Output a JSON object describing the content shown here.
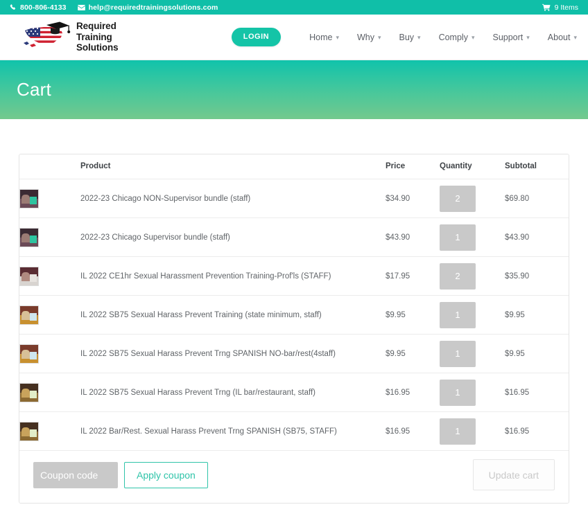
{
  "topbar": {
    "phone": "800-806-4133",
    "phone_icon": "phone-icon",
    "email": "help@requiredtrainingsolutions.com",
    "email_icon": "envelope-icon",
    "cart_icon": "shopping-cart-icon",
    "cart_label": "9 Items",
    "bg_color": "#10bfa8"
  },
  "header": {
    "logo_icon": "us-flag-map-graduation-cap-logo",
    "brand_line1": "Required",
    "brand_line2": "Training",
    "brand_line3": "Solutions",
    "login_label": "LOGIN",
    "login_color": "#14c4a7",
    "caret_icon": "chevron-down-icon",
    "nav": [
      {
        "label": "Home"
      },
      {
        "label": "Why"
      },
      {
        "label": "Buy"
      },
      {
        "label": "Comply"
      },
      {
        "label": "Support"
      },
      {
        "label": "About"
      }
    ]
  },
  "banner": {
    "title": "Cart",
    "gradient_from": "#10c3ab",
    "gradient_to": "#74c98d"
  },
  "cart": {
    "columns": {
      "thumb": "",
      "product": "Product",
      "price": "Price",
      "quantity": "Quantity",
      "subtotal": "Subtotal"
    },
    "items": [
      {
        "name": "2022-23 Chicago NON-Supervisor bundle (staff)",
        "price": "$34.90",
        "quantity": "2",
        "subtotal": "$69.80",
        "thumb": "crowd-photo-thumbnail"
      },
      {
        "name": "2022-23 Chicago Supervisor bundle (staff)",
        "price": "$43.90",
        "quantity": "1",
        "subtotal": "$43.90",
        "thumb": "crowd-photo-thumbnail"
      },
      {
        "name": "IL 2022 CE1hr Sexual Harassment Prevention Training-Prof'ls (STAFF)",
        "price": "$17.95",
        "quantity": "2",
        "subtotal": "$35.90",
        "thumb": "woman-portrait-thumbnail"
      },
      {
        "name": "IL 2022 SB75 Sexual Harass Prevent Training (state minimum, staff)",
        "price": "$9.95",
        "quantity": "1",
        "subtotal": "$9.95",
        "thumb": "office-photo-thumbnail"
      },
      {
        "name": "IL 2022 SB75 Sexual Harass Prevent Trng SPANISH NO-bar/rest(4staff)",
        "price": "$9.95",
        "quantity": "1",
        "subtotal": "$9.95",
        "thumb": "office-photo-thumbnail"
      },
      {
        "name": "IL 2022 SB75 Sexual Harass Prevent Trng (IL bar/restaurant, staff)",
        "price": "$16.95",
        "quantity": "1",
        "subtotal": "$16.95",
        "thumb": "restaurant-photo-thumbnail"
      },
      {
        "name": "IL 2022 Bar/Rest. Sexual Harass Prevent Trng SPANISH (SB75, STAFF)",
        "price": "$16.95",
        "quantity": "1",
        "subtotal": "$16.95",
        "thumb": "restaurant-photo-thumbnail"
      }
    ],
    "coupon_placeholder": "Coupon code",
    "coupon_value": "",
    "apply_label": "Apply coupon",
    "update_label": "Update cart"
  }
}
